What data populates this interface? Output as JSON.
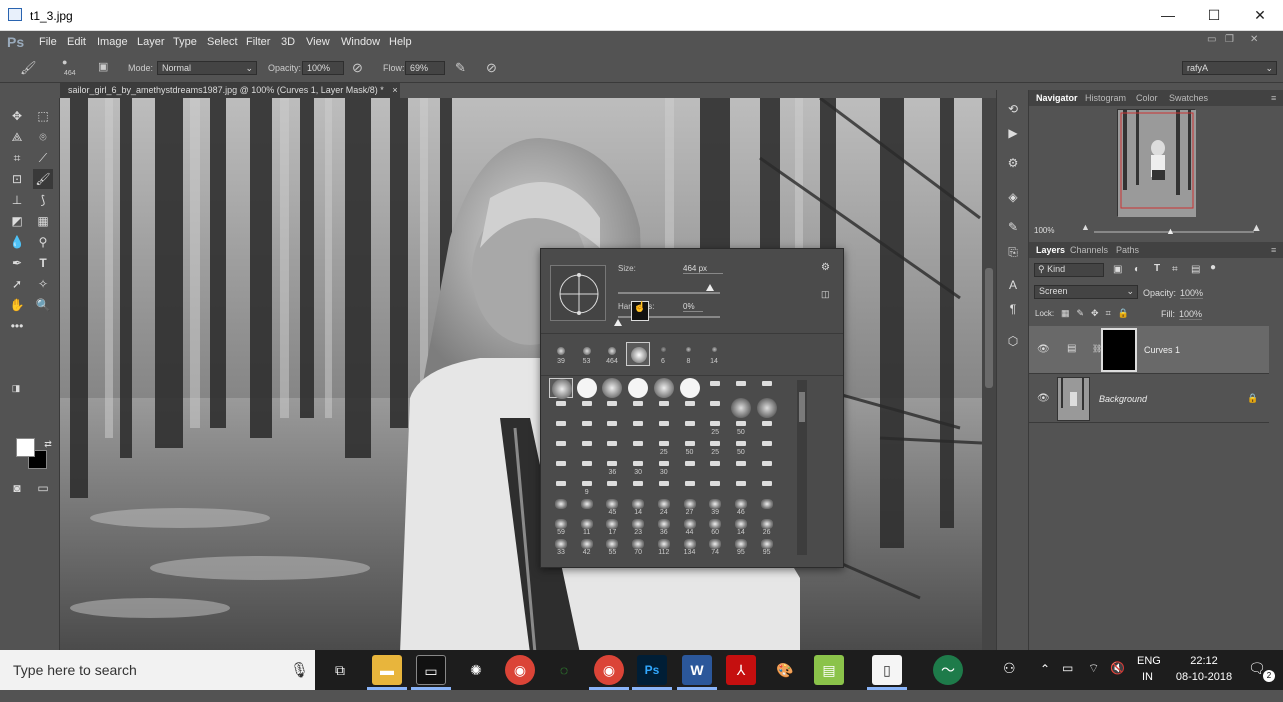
{
  "window": {
    "title": "t1_3.jpg",
    "min": "—",
    "max": "☐",
    "close": "✕"
  },
  "menubar": {
    "app": "Ps",
    "items": [
      "File",
      "Edit",
      "Image",
      "Layer",
      "Type",
      "Select",
      "Filter",
      "3D",
      "View",
      "Window",
      "Help"
    ]
  },
  "options": {
    "brush_size": "464",
    "mode_label": "Mode:",
    "mode_value": "Normal",
    "opacity_label": "Opacity:",
    "opacity_value": "100%",
    "flow_label": "Flow:",
    "flow_value": "69%",
    "workspace": "rafyA"
  },
  "document": {
    "tab": "sailor_girl_6_by_amethystdreams1987.jpg @ 100% (Curves 1, Layer Mask/8) *",
    "close": "×"
  },
  "brush_popup": {
    "size_label": "Size:",
    "size_value": "464 px",
    "hardness_label": "Hardness:",
    "hardness_value": "0%",
    "size_fraction": 0.9,
    "hardness_fraction": 0.0,
    "recent": [
      "39",
      "53",
      "464",
      "",
      "6",
      "8",
      "14"
    ],
    "rows": [
      [
        "",
        "",
        "",
        "",
        "",
        "",
        "",
        "",
        ""
      ],
      [
        "",
        "",
        "",
        "",
        "",
        "",
        "",
        "",
        ""
      ],
      [
        "",
        "",
        "",
        "",
        "",
        "",
        "25",
        "50",
        ""
      ],
      [
        "",
        "",
        "",
        "",
        "25",
        "50",
        "25",
        "50",
        ""
      ],
      [
        "",
        "",
        "36",
        "30",
        "30",
        "",
        "",
        "",
        ""
      ],
      [
        "",
        "9",
        "",
        "",
        "",
        "",
        "",
        "",
        ""
      ],
      [
        "",
        "",
        "45",
        "14",
        "24",
        "27",
        "39",
        "46",
        ""
      ],
      [
        "59",
        "11",
        "17",
        "23",
        "36",
        "44",
        "60",
        "14",
        "26"
      ],
      [
        "33",
        "42",
        "55",
        "70",
        "112",
        "134",
        "74",
        "95",
        "95"
      ]
    ]
  },
  "navigator": {
    "tabs": [
      "Navigator",
      "Histogram",
      "Color",
      "Swatches"
    ],
    "zoom": "100%"
  },
  "layers_panel": {
    "tabs": [
      "Layers",
      "Channels",
      "Paths"
    ],
    "kind": "Kind",
    "blend": "Screen",
    "opacity_label": "Opacity:",
    "opacity_value": "100%",
    "lock_label": "Lock:",
    "fill_label": "Fill:",
    "fill_value": "100%",
    "layers": [
      {
        "name": "Curves 1"
      },
      {
        "name": "Background"
      }
    ]
  },
  "taskbar": {
    "search_placeholder": "Type here to search",
    "lang1": "ENG",
    "lang2": "IN",
    "time": "22:12",
    "date": "08-10-2018",
    "notif": "2"
  }
}
